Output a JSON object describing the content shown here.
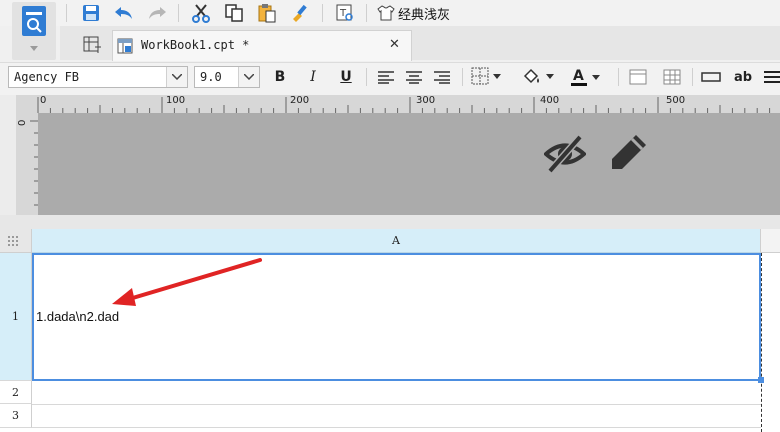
{
  "toolbar": {
    "theme_label": "经典浅灰",
    "icons": [
      "save-icon",
      "undo-icon",
      "redo-icon",
      "cut-icon",
      "copy-icon",
      "paste-icon",
      "format-painter-icon",
      "text-search-icon",
      "theme-icon"
    ]
  },
  "tab": {
    "title": "WorkBook1.cpt *",
    "close": "✕"
  },
  "format": {
    "font_name": "Agency FB",
    "font_size": "9.0",
    "bold": "B",
    "italic": "I",
    "underline": "U",
    "text_ab": "ab"
  },
  "ruler": {
    "labels": [
      "0",
      "100",
      "200",
      "300",
      "400",
      "500"
    ],
    "left_label": "0"
  },
  "grid": {
    "column_header": "A",
    "rows": [
      "1",
      "2",
      "3"
    ],
    "cell_A1": "1.dada\\n2.dad"
  },
  "colors": {
    "accent": "#2f7cd3",
    "selection": "#4c8ee0",
    "annotation_arrow": "#e02424"
  }
}
